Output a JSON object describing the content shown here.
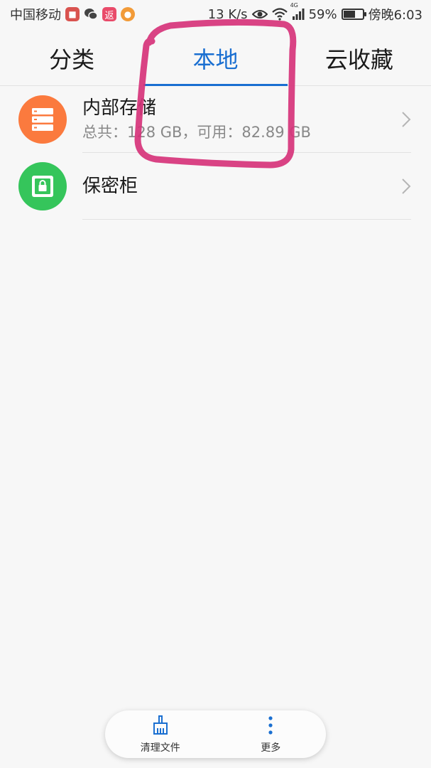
{
  "status_bar": {
    "carrier": "中国移动",
    "speed": "13 K/s",
    "network_badge": "4G",
    "battery_percent": "59%",
    "battery_level": 0.59,
    "time": "傍晚6:03",
    "app_icons": [
      "red-app-icon",
      "wechat-icon",
      "fan-app-icon",
      "orange-app-icon"
    ],
    "fan_icon_text": "返"
  },
  "tabs": [
    {
      "label": "分类",
      "active": false
    },
    {
      "label": "本地",
      "active": true
    },
    {
      "label": "云收藏",
      "active": false
    }
  ],
  "list": [
    {
      "title": "内部存储",
      "subtitle": "总共：128 GB，可用：82.89 GB",
      "icon": "storage-icon",
      "color": "#fb7a3e"
    },
    {
      "title": "保密柜",
      "icon": "safe-icon",
      "color": "#35c55b"
    }
  ],
  "bottom_bar": {
    "clean": {
      "label": "清理文件",
      "icon": "broom-icon"
    },
    "more": {
      "label": "更多",
      "icon": "more-vertical-icon"
    }
  },
  "colors": {
    "accent": "#1a6fd1",
    "annotation": "#d6337a"
  }
}
